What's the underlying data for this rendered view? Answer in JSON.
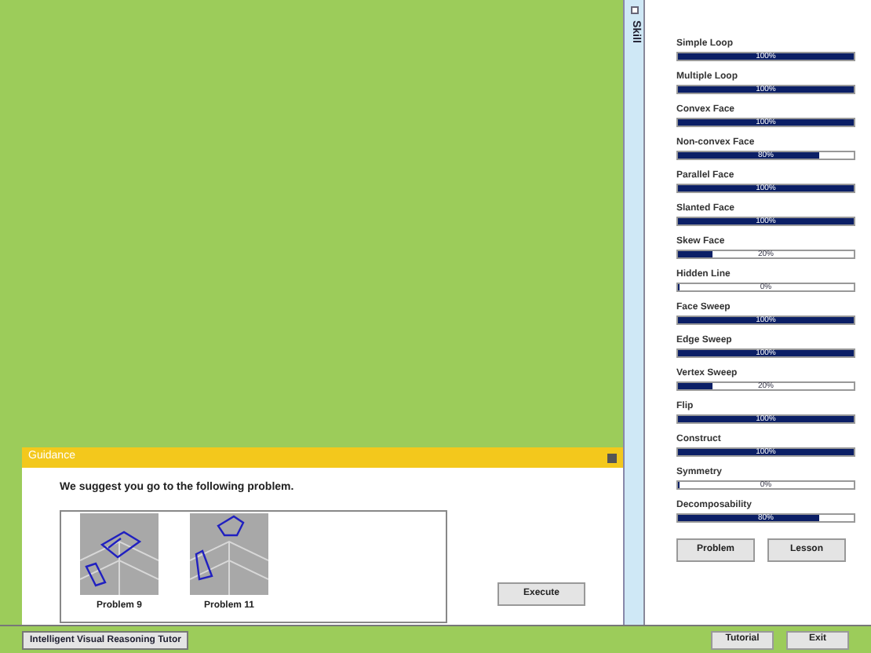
{
  "skill_tab": {
    "label": "Skill"
  },
  "skills": [
    {
      "name": "Simple Loop",
      "level": 1,
      "reading": "100%"
    },
    {
      "name": "Multiple Loop",
      "level": 1,
      "reading": "100%"
    },
    {
      "name": "Convex Face",
      "level": 1,
      "reading": "100%"
    },
    {
      "name": "Non-convex Face",
      "level": 0.8,
      "reading": "80%"
    },
    {
      "name": "Parallel Face",
      "level": 1,
      "reading": "100%"
    },
    {
      "name": "Slanted Face",
      "level": 1,
      "reading": "100%"
    },
    {
      "name": "Skew Face",
      "level": 0.2,
      "reading": "20%"
    },
    {
      "name": "Hidden Line",
      "level": 0,
      "reading": "0%"
    },
    {
      "name": "Face Sweep",
      "level": 1,
      "reading": "100%"
    },
    {
      "name": "Edge Sweep",
      "level": 1,
      "reading": "100%"
    },
    {
      "name": "Vertex Sweep",
      "level": 0.2,
      "reading": "20%"
    },
    {
      "name": "Flip",
      "level": 1,
      "reading": "100%"
    },
    {
      "name": "Construct",
      "level": 1,
      "reading": "100%"
    },
    {
      "name": "Symmetry",
      "level": 0,
      "reading": "0%"
    },
    {
      "name": "Decomposability",
      "level": 0.8,
      "reading": "80%"
    }
  ],
  "skill_buttons": [
    "Problem",
    "Lesson"
  ],
  "guidance": {
    "title": "Guidance",
    "message": "We suggest you go to the following problem.",
    "problems": [
      {
        "label": "Problem 9"
      },
      {
        "label": "Problem 11"
      }
    ],
    "button": "Execute"
  },
  "taskbar": {
    "tab": "Intelligent Visual Reasoning Tutor",
    "buttons": [
      "Tutorial",
      "Exit"
    ]
  }
}
